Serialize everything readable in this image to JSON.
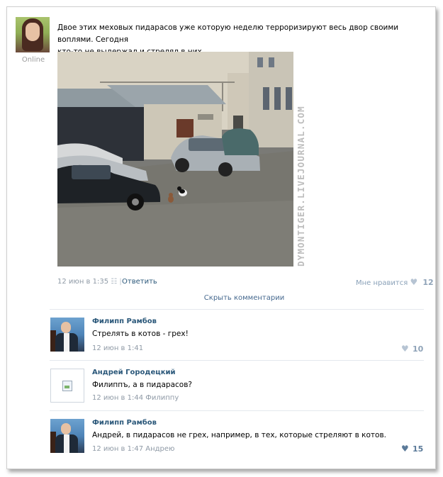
{
  "post": {
    "avatar_status": "Online",
    "text_line1": "Двое этих меховых пидарасов уже которую неделю терроризируют весь двор своими воплями. Сегодня",
    "text_line2": "кто-то не выдержал и стрелял в них.",
    "watermark": "DYMONTIGER.LIVEJOURNAL.COM",
    "timestamp": "12 июн в 1:35",
    "mobile_icon": "phone-icon",
    "reply_label": "Ответить",
    "like_label": "Мне нравится",
    "like_count": "12"
  },
  "hide_comments_label": "Скрыть комментарии",
  "comments": [
    {
      "author": "Филипп Рамбов",
      "text": "Стрелять в котов - грех!",
      "timestamp": "12 июн в 1:41",
      "reply_to": "",
      "like_count": "10"
    },
    {
      "author": "Андрей Городецкий",
      "text": "Филиппъ, а в пидарасов?",
      "timestamp": "12 июн в 1:44",
      "reply_to": "Филиппу",
      "like_count": ""
    },
    {
      "author": "Филипп Рамбов",
      "text": "Андрей, в пидарасов не грех, например, в тех, которые стреляют в котов.",
      "timestamp": "12 июн в 1:47",
      "reply_to": "Андрею",
      "like_count": "15"
    }
  ],
  "colors": {
    "link": "#2b587a",
    "meta_gray": "#8f9aa6",
    "like_icon": "#b6c4d3",
    "divider": "#e4e8ed"
  }
}
